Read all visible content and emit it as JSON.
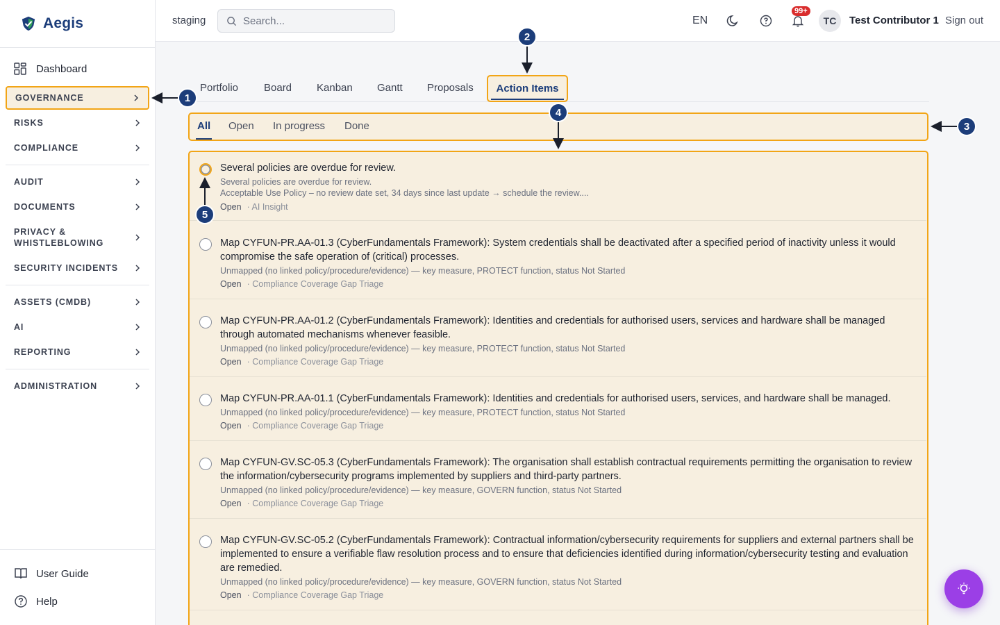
{
  "app": {
    "name": "Aegis",
    "environment": "staging"
  },
  "search": {
    "placeholder": "Search..."
  },
  "topbar": {
    "language": "EN",
    "notification_badge": "99+",
    "avatar_initials": "TC",
    "user_name": "Test Contributor 1",
    "sign_out": "Sign out"
  },
  "sidebar": {
    "dashboard": "Dashboard",
    "groups": [
      {
        "label": "GOVERNANCE",
        "active": true
      },
      {
        "label": "RISKS"
      },
      {
        "label": "COMPLIANCE"
      },
      {
        "label": "AUDIT"
      },
      {
        "label": "DOCUMENTS"
      },
      {
        "label": "PRIVACY &",
        "label2": "WHISTLEBLOWING"
      },
      {
        "label": "SECURITY INCIDENTS"
      },
      {
        "label": "ASSETS (CMDB)"
      },
      {
        "label": "AI"
      },
      {
        "label": "REPORTING"
      },
      {
        "label": "ADMINISTRATION"
      }
    ],
    "bottom": {
      "user_guide": "User Guide",
      "help": "Help"
    }
  },
  "tabs": [
    "Portfolio",
    "Board",
    "Kanban",
    "Gantt",
    "Proposals",
    "Action Items"
  ],
  "active_tab": "Action Items",
  "filters": [
    "All",
    "Open",
    "In progress",
    "Done"
  ],
  "active_filter": "All",
  "items": [
    {
      "title": "Several policies are overdue for review.",
      "desc1": "Several policies are overdue for review.",
      "desc2": "Acceptable Use Policy – no review date set, 34 days since last update → schedule the review....",
      "status": "Open",
      "source": "· AI Insight"
    },
    {
      "title": "Map CYFUN-PR.AA-01.3 (CyberFundamentals Framework): System credentials shall be deactivated after a specified period of inactivity unless it would compromise the safe operation of (critical) processes.",
      "desc1": "Unmapped (no linked policy/procedure/evidence) — key measure, PROTECT function, status Not Started",
      "status": "Open",
      "source": "· Compliance Coverage Gap Triage"
    },
    {
      "title": "Map CYFUN-PR.AA-01.2 (CyberFundamentals Framework): Identities and credentials for authorised users, services and hardware shall be managed through automated mechanisms whenever feasible.",
      "desc1": "Unmapped (no linked policy/procedure/evidence) — key measure, PROTECT function, status Not Started",
      "status": "Open",
      "source": "· Compliance Coverage Gap Triage"
    },
    {
      "title": "Map CYFUN-PR.AA-01.1 (CyberFundamentals Framework): Identities and credentials for authorised users, services, and hardware shall be managed.",
      "desc1": "Unmapped (no linked policy/procedure/evidence) — key measure, PROTECT function, status Not Started",
      "status": "Open",
      "source": "· Compliance Coverage Gap Triage"
    },
    {
      "title": "Map CYFUN-GV.SC-05.3 (CyberFundamentals Framework): The organisation shall establish contractual requirements permitting the organisation to review the information/cybersecurity programs implemented by suppliers and third-party partners.",
      "desc1": "Unmapped (no linked policy/procedure/evidence) — key measure, GOVERN function, status Not Started",
      "status": "Open",
      "source": "· Compliance Coverage Gap Triage"
    },
    {
      "title": "Map CYFUN-GV.SC-05.2 (CyberFundamentals Framework): Contractual information/cybersecurity requirements for suppliers and external partners shall be implemented to ensure a verifiable flaw resolution process and to ensure that deficiencies identified during information/cybersecurity testing and evaluation are remedied.",
      "desc1": "Unmapped (no linked policy/procedure/evidence) — key measure, GOVERN function, status Not Started",
      "status": "Open",
      "source": "· Compliance Coverage Gap Triage"
    }
  ],
  "callouts": [
    "1",
    "2",
    "3",
    "4",
    "5"
  ],
  "colors": {
    "accent": "#1c3d7a",
    "highlight": "#f2a516",
    "highlight_fill": "#f7efe0",
    "badge": "#d92d2d",
    "fab": "#9b3fe6"
  }
}
